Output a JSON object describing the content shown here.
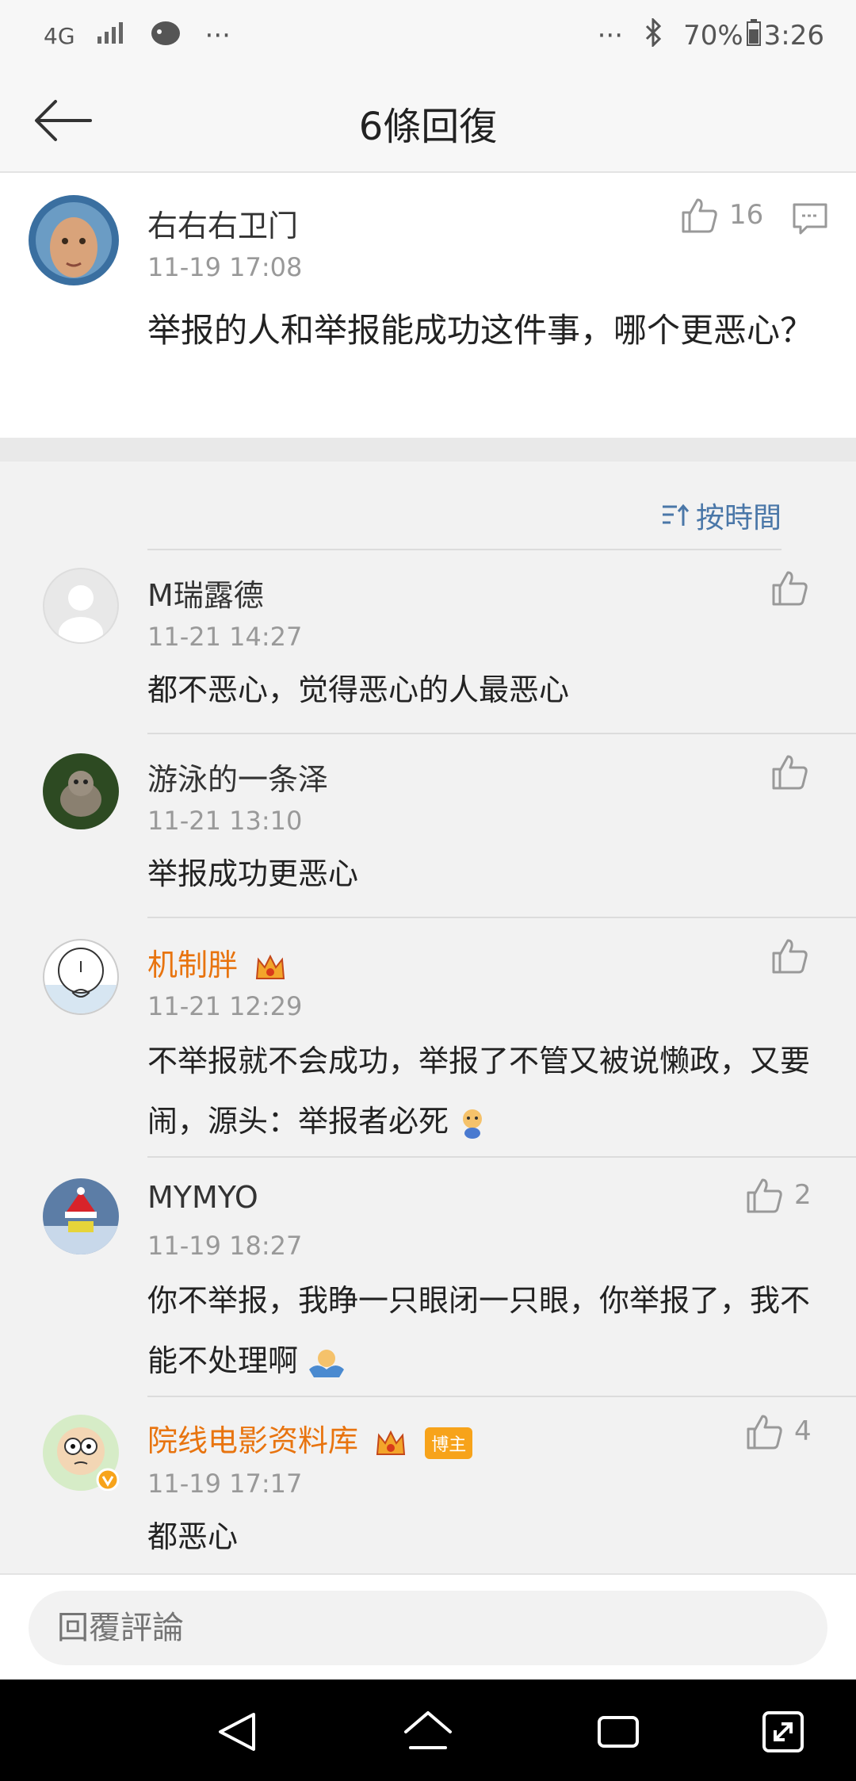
{
  "status": {
    "network": "4G",
    "battery": "70%",
    "time": "3:26"
  },
  "header": {
    "title": "6條回復"
  },
  "original": {
    "username": "右右右卫门",
    "time": "11-19 17:08",
    "text": "举报的人和举报能成功这件事，哪个更恶心？",
    "likes": "16"
  },
  "sort": {
    "label": "按時間"
  },
  "comments": [
    {
      "username": "M瑞露德",
      "time": "11-21 14:27",
      "text": "都不恶心，觉得恶心的人最恶心",
      "likes": ""
    },
    {
      "username": "游泳的一条泽",
      "time": "11-21 13:10",
      "text": "举报成功更恶心",
      "likes": ""
    },
    {
      "username": "机制胖",
      "time": "11-21 12:29",
      "text": "不举报就不会成功，举报了不管又被说懒政，又要闹，源头：举报者必死",
      "likes": ""
    },
    {
      "username": "MYMYO",
      "time": "11-19 18:27",
      "text": "你不举报，我睁一只眼闭一只眼，你举报了，我不能不处理啊",
      "likes": "2"
    },
    {
      "username": "院线电影资料库",
      "badge": "博主",
      "time": "11-19 17:17",
      "text": "都恶心",
      "likes": "4"
    }
  ],
  "reply": {
    "placeholder": "回覆評論"
  },
  "colors": {
    "accent_blue": "#4a77a8",
    "vip_orange": "#e8740f",
    "badge_orange": "#f7a31a"
  }
}
